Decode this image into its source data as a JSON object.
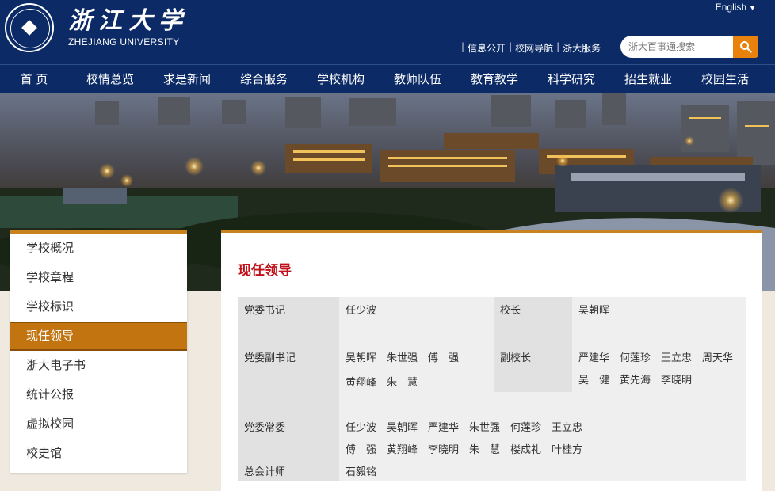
{
  "header": {
    "logo_cn": "浙江大学",
    "logo_en": "ZHEJIANG UNIVERSITY",
    "lang": "English",
    "links": [
      "信息公开",
      "校网导航",
      "浙大服务"
    ],
    "search_placeholder": "浙大百事通搜索"
  },
  "nav": [
    "首 页",
    "校情总览",
    "求是新闻",
    "综合服务",
    "学校机构",
    "教师队伍",
    "教育教学",
    "科学研究",
    "招生就业",
    "校园生活"
  ],
  "sidebar": [
    "学校概况",
    "学校章程",
    "学校标识",
    "现任领导",
    "浙大电子书",
    "统计公报",
    "虚拟校园",
    "校史馆"
  ],
  "page_title": "现任领导",
  "leaders": {
    "party_secretary_label": "党委书记",
    "party_secretary": "任少波",
    "president_label": "校长",
    "president": "吴朝晖",
    "deputy_secretary_label": "党委副书记",
    "deputy_secretary_line1": "吴朝晖　朱世强　傅　强",
    "deputy_secretary_line2": "黄翔峰　朱　慧",
    "vice_president_label": "副校长",
    "vice_president_line1": "严建华　何莲珍　王立忠　周天华",
    "vice_president_line2": "吴　健　黄先海　李晓明",
    "standing_committee_label": "党委常委",
    "standing_committee_line1": "任少波　吴朝晖　严建华　朱世强　何莲珍　王立忠",
    "standing_committee_line2": "傅　强　黄翔峰　李晓明　朱　慧　楼成礼　叶桂方",
    "chief_accountant_label": "总会计师",
    "chief_accountant": "石毅铭"
  },
  "colors": {
    "nav_bg": "#0b2a66",
    "accent": "#c8821e",
    "active": "#c27410",
    "title": "#c0101a"
  }
}
